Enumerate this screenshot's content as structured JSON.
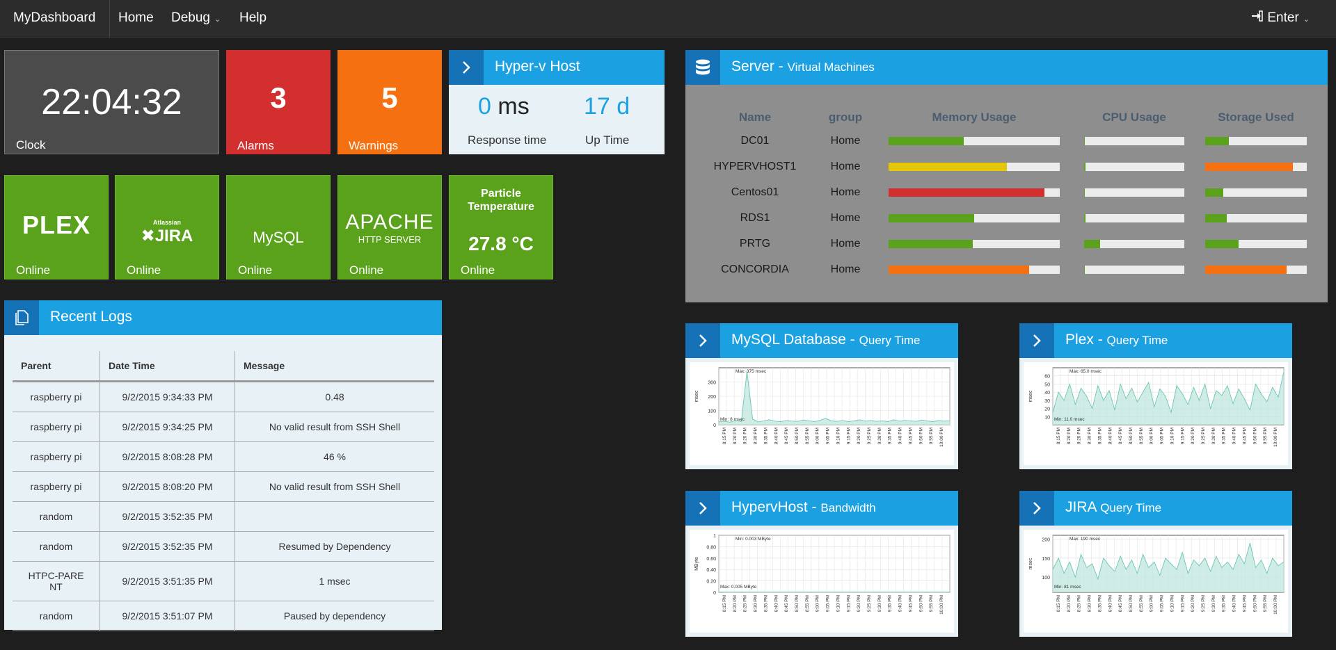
{
  "nav": {
    "brand": "MyDashboard",
    "items": [
      {
        "label": "Home"
      },
      {
        "label": "Debug",
        "has_caret": true
      },
      {
        "label": "Help"
      }
    ],
    "enter_label": "Enter"
  },
  "tiles": {
    "clock": {
      "value": "22:04:32",
      "label": "Clock"
    },
    "alarms": {
      "value": "3",
      "label": "Alarms"
    },
    "warnings": {
      "value": "5",
      "label": "Warnings"
    },
    "services": [
      {
        "logo": "PLEX",
        "status": "Online"
      },
      {
        "logo_small": "Atlassian",
        "logo": "JIRA",
        "status": "Online"
      },
      {
        "logo": "MySQL",
        "status": "Online"
      },
      {
        "logo": "APACHE",
        "logo_sub": "HTTP SERVER",
        "status": "Online"
      },
      {
        "title": "Particle Temperature",
        "value": "27.8 °C",
        "status": "Online"
      }
    ]
  },
  "hyperv": {
    "title": "Hyper-v Host",
    "response_value": "0",
    "response_unit": "ms",
    "response_label": "Response time",
    "uptime_value": "17 d",
    "uptime_label": "Up Time"
  },
  "server": {
    "title": "Server",
    "subtitle": "Virtual Machines",
    "columns": [
      "Name",
      "group",
      "Memory Usage",
      "CPU Usage",
      "Storage Used"
    ],
    "rows": [
      {
        "name": "DC01",
        "group": "Home",
        "memory": 0.44,
        "memory_color": "#5aa21c",
        "cpu": 0.0,
        "cpu_color": "#5aa21c",
        "storage": 0.23,
        "storage_color": "#5aa21c"
      },
      {
        "name": "HYPERVHOST1",
        "group": "Home",
        "memory": 0.69,
        "memory_color": "#e5c60b",
        "cpu": 0.01,
        "cpu_color": "#5aa21c",
        "storage": 0.86,
        "storage_color": "#f57010"
      },
      {
        "name": "Centos01",
        "group": "Home",
        "memory": 0.91,
        "memory_color": "#d32f2f",
        "cpu": 0.0,
        "cpu_color": "#5aa21c",
        "storage": 0.18,
        "storage_color": "#5aa21c"
      },
      {
        "name": "RDS1",
        "group": "Home",
        "memory": 0.5,
        "memory_color": "#5aa21c",
        "cpu": 0.01,
        "cpu_color": "#5aa21c",
        "storage": 0.21,
        "storage_color": "#5aa21c"
      },
      {
        "name": "PRTG",
        "group": "Home",
        "memory": 0.49,
        "memory_color": "#5aa21c",
        "cpu": 0.16,
        "cpu_color": "#5aa21c",
        "storage": 0.33,
        "storage_color": "#5aa21c"
      },
      {
        "name": "CONCORDIA",
        "group": "Home",
        "memory": 0.82,
        "memory_color": "#f57010",
        "cpu": 0.0,
        "cpu_color": "#5aa21c",
        "storage": 0.8,
        "storage_color": "#f57010"
      }
    ]
  },
  "logs": {
    "title": "Recent Logs",
    "columns": [
      "Parent",
      "Date Time",
      "Message"
    ],
    "rows": [
      {
        "parent": "raspberry pi",
        "datetime": "9/2/2015 9:34:33 PM",
        "message": "0.48"
      },
      {
        "parent": "raspberry pi",
        "datetime": "9/2/2015 9:34:25 PM",
        "message": "No valid result from SSH Shell"
      },
      {
        "parent": "raspberry pi",
        "datetime": "9/2/2015 8:08:28 PM",
        "message": "46 %"
      },
      {
        "parent": "raspberry pi",
        "datetime": "9/2/2015 8:08:20 PM",
        "message": "No valid result from SSH Shell"
      },
      {
        "parent": "random",
        "datetime": "9/2/2015 3:52:35 PM",
        "message": ""
      },
      {
        "parent": "random",
        "datetime": "9/2/2015 3:52:35 PM",
        "message": "Resumed by Dependency"
      },
      {
        "parent": "HTPC-PARENT",
        "datetime": "9/2/2015 3:51:35 PM",
        "message": "1 msec"
      },
      {
        "parent": "random",
        "datetime": "9/2/2015 3:51:07 PM",
        "message": "Paused by dependency"
      }
    ]
  },
  "charts_widgets": [
    {
      "title": "MySQL Database",
      "subtitle": "Query Time"
    },
    {
      "title": "Plex",
      "subtitle": "Query Time"
    },
    {
      "title": "HypervHost",
      "subtitle": "Bandwidth"
    },
    {
      "title": "JIRA",
      "subtitle": "Query Time"
    }
  ],
  "chart_data": [
    {
      "type": "area",
      "ylabel": "msec",
      "ylim": [
        0,
        400
      ],
      "yticks": [
        0,
        100,
        200,
        300
      ],
      "x": [
        "8:15 PM",
        "8:20 PM",
        "8:25 PM",
        "8:30 PM",
        "8:35 PM",
        "8:40 PM",
        "8:45 PM",
        "8:50 PM",
        "8:55 PM",
        "9:00 PM",
        "9:05 PM",
        "9:10 PM",
        "9:15 PM",
        "9:20 PM",
        "9:25 PM",
        "9:30 PM",
        "9:35 PM",
        "9:40 PM",
        "9:45 PM",
        "9:50 PM",
        "9:55 PM",
        "10:00 PM"
      ],
      "values": [
        20,
        25,
        18,
        30,
        22,
        375,
        40,
        20,
        28,
        35,
        25,
        22,
        30,
        26,
        24,
        33,
        28,
        22,
        31,
        45,
        27,
        24,
        30,
        22,
        28,
        35,
        26,
        30,
        24,
        28,
        22,
        35,
        26,
        30,
        28,
        24,
        33,
        27,
        22,
        30,
        26,
        28
      ],
      "annotations": [
        "Max: 375 msec",
        "Min: 8 msec"
      ]
    },
    {
      "type": "area",
      "ylabel": "msec",
      "ylim": [
        0,
        70
      ],
      "yticks": [
        10,
        20,
        30,
        40,
        50,
        60
      ],
      "x": [
        "8:15 PM",
        "8:20 PM",
        "8:25 PM",
        "8:30 PM",
        "8:35 PM",
        "8:40 PM",
        "8:45 PM",
        "8:50 PM",
        "8:55 PM",
        "9:00 PM",
        "9:05 PM",
        "9:10 PM",
        "9:15 PM",
        "9:20 PM",
        "9:25 PM",
        "9:30 PM",
        "9:35 PM",
        "9:40 PM",
        "9:45 PM",
        "9:50 PM",
        "9:55 PM",
        "10:00 PM"
      ],
      "values": [
        15,
        40,
        30,
        50,
        25,
        45,
        35,
        20,
        48,
        30,
        42,
        18,
        50,
        32,
        45,
        28,
        40,
        52,
        22,
        44,
        35,
        15,
        48,
        38,
        25,
        46,
        30,
        50,
        20,
        42,
        36,
        48,
        26,
        44,
        32,
        18,
        50,
        38,
        28,
        46,
        34,
        65
      ],
      "annotations": [
        "Max: 65.0 msec",
        "Min: 11.0 msec"
      ]
    },
    {
      "type": "area",
      "ylabel": "MByte",
      "ylim": [
        0,
        1
      ],
      "yticks": [
        0.0,
        0.2,
        0.4,
        0.6,
        0.8,
        1.0
      ],
      "x": [
        "8:15 PM",
        "8:20 PM",
        "8:25 PM",
        "8:30 PM",
        "8:35 PM",
        "8:40 PM",
        "8:45 PM",
        "8:50 PM",
        "8:55 PM",
        "9:00 PM",
        "9:05 PM",
        "9:10 PM",
        "9:15 PM",
        "9:20 PM",
        "9:25 PM",
        "9:30 PM",
        "9:35 PM",
        "9:40 PM",
        "9:45 PM",
        "9:50 PM",
        "9:55 PM",
        "10:00 PM"
      ],
      "values": [
        0.004,
        0.004,
        0.004,
        0.004,
        0.004,
        0.004,
        0.004,
        0.004,
        0.004,
        0.004,
        0.004,
        0.004,
        0.004,
        0.004,
        0.004,
        0.004,
        0.004,
        0.004,
        0.004,
        0.004
      ],
      "annotations": [
        "Min: 0.003 MByte",
        "Max: 0.005 MByte"
      ]
    },
    {
      "type": "area",
      "ylabel": "msec",
      "ylim": [
        60,
        210
      ],
      "yticks": [
        100,
        150,
        200
      ],
      "x": [
        "8:15 PM",
        "8:20 PM",
        "8:25 PM",
        "8:30 PM",
        "8:35 PM",
        "8:40 PM",
        "8:45 PM",
        "8:50 PM",
        "8:55 PM",
        "9:00 PM",
        "9:05 PM",
        "9:10 PM",
        "9:15 PM",
        "9:20 PM",
        "9:25 PM",
        "9:30 PM",
        "9:35 PM",
        "9:40 PM",
        "9:45 PM",
        "9:50 PM",
        "9:55 PM",
        "10:00 PM"
      ],
      "values": [
        120,
        150,
        110,
        140,
        100,
        160,
        125,
        135,
        95,
        150,
        130,
        115,
        155,
        120,
        145,
        110,
        160,
        125,
        140,
        105,
        150,
        135,
        120,
        165,
        110,
        145,
        130,
        150,
        115,
        155,
        125,
        140,
        120,
        160,
        135,
        190,
        125,
        145,
        110,
        150,
        130,
        140
      ],
      "annotations": [
        "Max: 190 msec",
        "Min: 81 msec"
      ]
    }
  ]
}
